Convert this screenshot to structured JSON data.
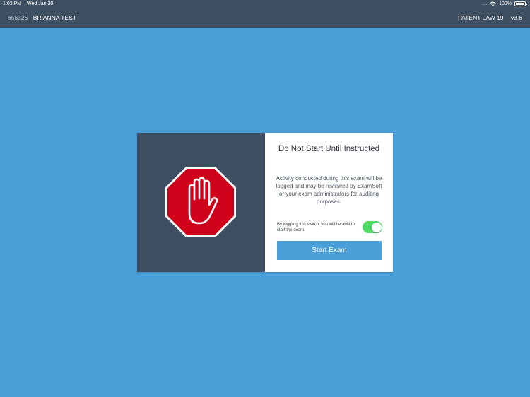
{
  "status_bar": {
    "time": "1:02 PM",
    "date": "Wed Jan 30",
    "signal": "....",
    "battery": "100%"
  },
  "header": {
    "student_id": "666326",
    "student_name": "BRIANNA TEST",
    "exam_name": "PATENT LAW 19",
    "version": "v3.6"
  },
  "dialog": {
    "icon": "stop-hand-icon",
    "title": "Do Not Start Until Instructed",
    "body": "Activity conducted during this exam will be logged and may be reviewed by ExamSoft or your exam administrators for auditing purposes.",
    "toggle_text": "By toggling this switch, you will be able to start the exam.",
    "toggle_on": true,
    "start_button_label": "Start Exam"
  },
  "colors": {
    "background": "#4a9fd9",
    "header": "#3e4f61",
    "stop_red": "#d0021b",
    "toggle_green": "#4cd964"
  }
}
